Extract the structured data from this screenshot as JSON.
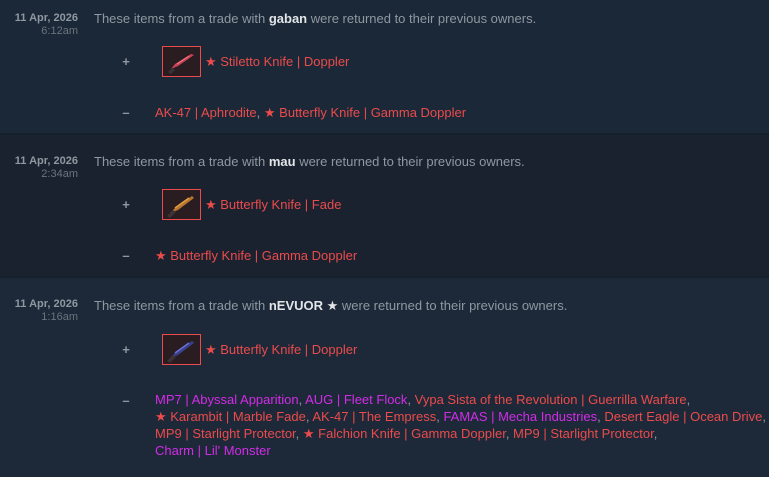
{
  "entries": [
    {
      "date": "11 Apr, 2026",
      "time": "6:12am",
      "desc_prefix": "These items from a trade with ",
      "user": "gaban",
      "desc_suffix": " were returned to their previous owners.",
      "plus_sign": "+",
      "minus_sign": "–",
      "received": {
        "name": "★ Stiletto Knife | Doppler",
        "icon": "stiletto-knife-icon"
      },
      "lost": [
        {
          "text": "AK-47 | Aphrodite",
          "rarity": "covert"
        },
        {
          "text": ", ",
          "rarity": "plain"
        },
        {
          "text": "★ Butterfly Knife | Gamma Doppler",
          "rarity": "covert"
        }
      ]
    },
    {
      "date": "11 Apr, 2026",
      "time": "2:34am",
      "desc_prefix": "These items from a trade with ",
      "user": "mau",
      "desc_suffix": " were returned to their previous owners.",
      "plus_sign": "+",
      "minus_sign": "–",
      "received": {
        "name": "★ Butterfly Knife | Fade",
        "icon": "butterfly-knife-icon"
      },
      "lost": [
        {
          "text": "★ Butterfly Knife | Gamma Doppler",
          "rarity": "covert"
        }
      ]
    },
    {
      "date": "11 Apr, 2026",
      "time": "1:16am",
      "desc_prefix": "These items from a trade with ",
      "user": "nEVUOR ★",
      "desc_suffix": " were returned to their previous owners.",
      "plus_sign": "+",
      "minus_sign": "–",
      "received": {
        "name": "★ Butterfly Knife | Doppler",
        "icon": "butterfly-knife-icon"
      },
      "lost_lines": [
        [
          {
            "text": "MP7 | Abyssal Apparition",
            "rarity": "classified"
          },
          {
            "text": ", ",
            "rarity": "plain"
          },
          {
            "text": "AUG | Fleet Flock",
            "rarity": "classified"
          },
          {
            "text": ", ",
            "rarity": "plain"
          },
          {
            "text": "Vypa Sista of the Revolution | Guerrilla Warfare",
            "rarity": "covert"
          },
          {
            "text": ",",
            "rarity": "plain"
          }
        ],
        [
          {
            "text": "★ Karambit | Marble Fade",
            "rarity": "covert"
          },
          {
            "text": ", ",
            "rarity": "plain"
          },
          {
            "text": "AK-47 | The Empress",
            "rarity": "covert"
          },
          {
            "text": ", ",
            "rarity": "plain"
          },
          {
            "text": "FAMAS | Mecha Industries",
            "rarity": "classified"
          },
          {
            "text": ", ",
            "rarity": "plain"
          },
          {
            "text": "Desert Eagle | Ocean Drive",
            "rarity": "covert"
          },
          {
            "text": ",",
            "rarity": "plain"
          }
        ],
        [
          {
            "text": "MP9 | Starlight Protector",
            "rarity": "covert"
          },
          {
            "text": ", ",
            "rarity": "plain"
          },
          {
            "text": "★ Falchion Knife | Gamma Doppler",
            "rarity": "covert"
          },
          {
            "text": ", ",
            "rarity": "plain"
          },
          {
            "text": "MP9 | Starlight Protector",
            "rarity": "covert"
          },
          {
            "text": ",",
            "rarity": "plain"
          }
        ],
        [
          {
            "text": "Charm | Lil' Monster",
            "rarity": "classified"
          }
        ]
      ]
    }
  ],
  "colors": {
    "covert": "#eb4b4b",
    "classified": "#d32ce6",
    "background": "#1b2838"
  }
}
